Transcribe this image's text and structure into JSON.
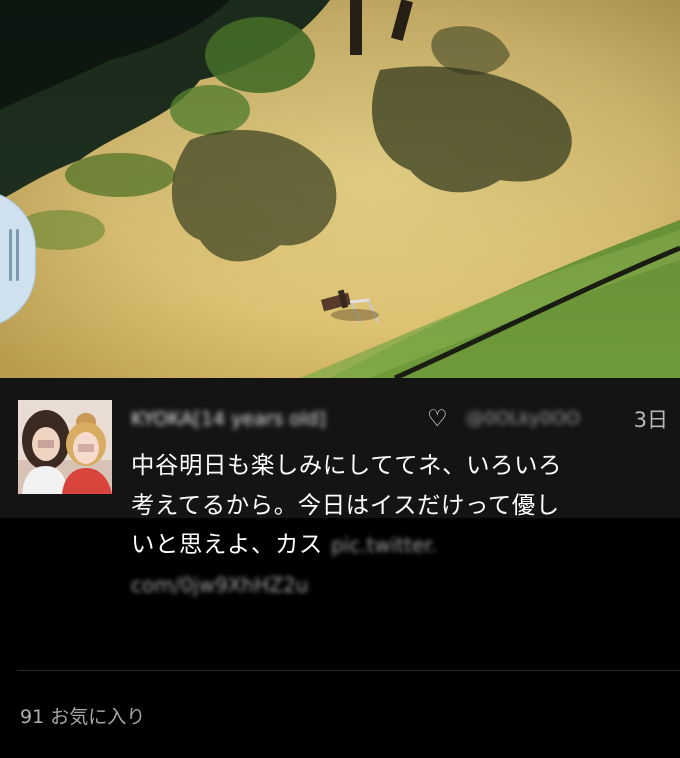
{
  "photo": {
    "description_icon": "park-photo"
  },
  "tweet": {
    "user_name": "KYOKA[14 years old]",
    "heart": "♡",
    "handle": "@0OLky0OO",
    "time": "3日",
    "text_lines": [
      "中谷明日も楽しみにしててネ、いろいろ",
      "考えてるから。今日はイスだけって優し",
      "いと思えよ、カス"
    ],
    "link_part1": "pic.twitter.",
    "link_part2": "com/0jw9XhHZ2u",
    "fav_count": "91",
    "fav_label": "お気に入り"
  },
  "colors": {
    "background": "#000000",
    "band": "#141414",
    "text": "#ffffff",
    "muted": "#a6a6a6"
  }
}
